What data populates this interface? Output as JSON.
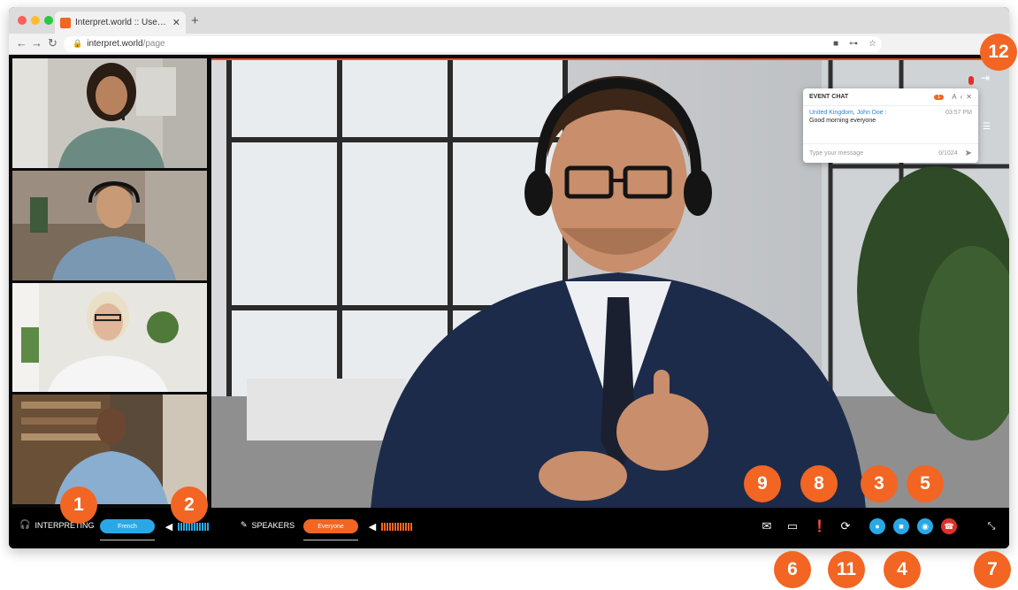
{
  "browser": {
    "tab_title": "Interpret.world :: User Interfac",
    "tab_close": "✕",
    "new_tab": "+",
    "url_domain": "interpret.world",
    "url_path": "/page"
  },
  "chat": {
    "title": "EVENT CHAT",
    "unread_badge": "1",
    "sender": "United Kingdom, John Doe :",
    "time": "03:57 PM",
    "message": "Good morning everyone",
    "input_placeholder": "Type your message",
    "char_counter": "0/1024"
  },
  "bottom_bar": {
    "interpreting_label": "INTERPRETING",
    "interpreting_language": "French",
    "speakers_label": "SPEAKERS",
    "speakers_selection": "Everyone"
  },
  "callouts": [
    "1",
    "2",
    "3",
    "4",
    "5",
    "6",
    "7",
    "8",
    "9",
    "11",
    "12"
  ],
  "colors": {
    "accent_orange": "#f26522",
    "accent_blue": "#2aa8e6",
    "end_call_red": "#e0302a"
  },
  "icons": {
    "headphones": "headphones-icon",
    "speaker": "speaker-icon",
    "mic": "microphone-icon",
    "message": "envelope-icon",
    "chat": "chat-icon",
    "report": "alert-icon",
    "swap": "refresh-icon",
    "camera": "camera-icon",
    "share": "share-icon",
    "hangup": "phone-hangup-icon",
    "fullscreen": "collapse-icon",
    "exit": "exit-icon"
  }
}
